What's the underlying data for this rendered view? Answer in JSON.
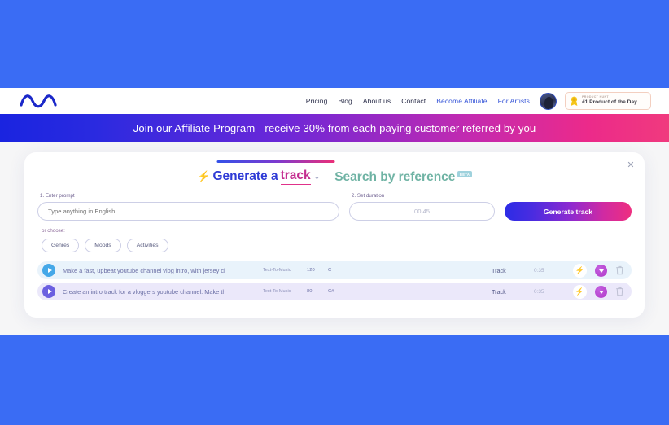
{
  "nav": {
    "logo_name": "mubert-wave-logo",
    "links": [
      {
        "label": "Pricing",
        "accent": false
      },
      {
        "label": "Blog",
        "accent": false
      },
      {
        "label": "About us",
        "accent": false
      },
      {
        "label": "Contact",
        "accent": false
      },
      {
        "label": "Become Affiliate",
        "accent": true
      },
      {
        "label": "For Artists",
        "accent": true
      }
    ],
    "product_hunt": {
      "top_label": "PRODUCT HUNT",
      "main_label": "#1 Product of the Day"
    }
  },
  "banner": {
    "text": "Join our Affiliate Program - receive 30% from each paying customer referred by you",
    "gradient_from": "#1a24e0",
    "gradient_to": "#f03a7e"
  },
  "card": {
    "close_label": "✕",
    "tabs": [
      {
        "bolt": "⚡",
        "prefix": "Generate a ",
        "highlight": "track",
        "chevron": "⌄",
        "active": true
      },
      {
        "label": "Search by reference",
        "badge": "BETA",
        "active": false
      }
    ],
    "prompt": {
      "label": "1. Enter prompt",
      "placeholder": "Type anything in English",
      "value": ""
    },
    "duration": {
      "label": "2. Set duration",
      "value": "00:45"
    },
    "generate_button": "Generate track",
    "or_choose_label": "or choose:",
    "chips": [
      "Genres",
      "Moods",
      "Activities"
    ],
    "tracks": [
      {
        "title": "Make a fast, upbeat youtube channel vlog intro, with jersey cl",
        "type": "Text-To-Music",
        "bpm": "120",
        "key": "C",
        "label": "Track",
        "duration": "0:35",
        "bolt_icon": "⚡",
        "download_icon": "download-icon",
        "delete_icon": "trash-icon"
      },
      {
        "title": "Create an intro track for a vloggers youtube channel. Make th",
        "type": "Text-To-Music",
        "bpm": "80",
        "key": "C#",
        "label": "Track",
        "duration": "0:35",
        "bolt_icon": "⚡",
        "download_icon": "download-icon",
        "delete_icon": "trash-icon"
      }
    ]
  },
  "colors": {
    "page_backdrop": "#3a6cf4",
    "page_bg": "#f6f6f7",
    "accent_blue": "#2e3ad6",
    "accent_pink": "#e0318a",
    "row_1_bg": "#e9f3fb",
    "row_2_bg": "#ebe8fa"
  }
}
